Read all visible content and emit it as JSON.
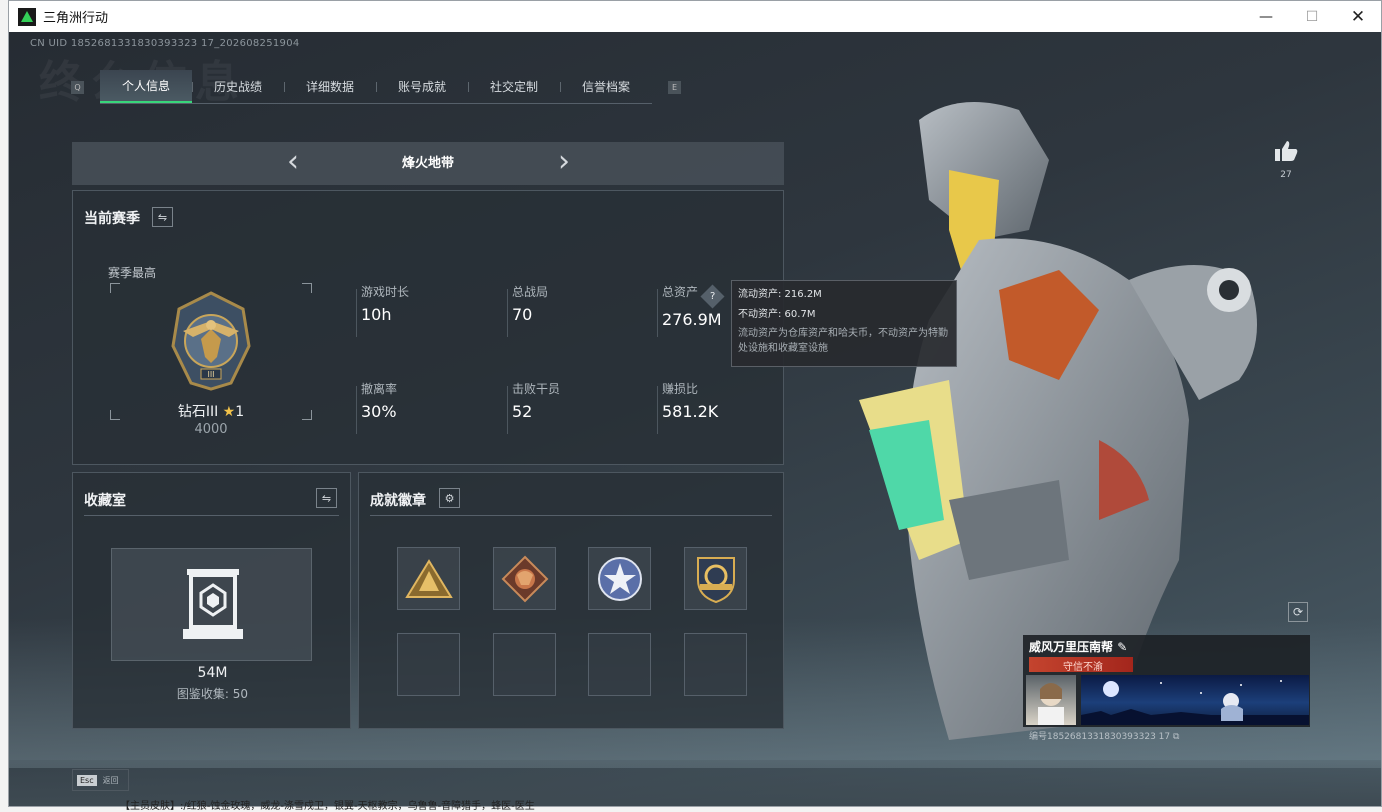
{
  "window": {
    "title": "三角洲行动",
    "min": "—",
    "max": "☐",
    "close": "✕"
  },
  "uid": "CN UID 1852681331830393323 17_202608251904",
  "bg_word": "终么信息",
  "tabs": {
    "left_key": "Q",
    "right_key": "E",
    "items": [
      {
        "label": "个人信息",
        "active": true
      },
      {
        "label": "历史战绩",
        "active": false
      },
      {
        "label": "详细数据",
        "active": false
      },
      {
        "label": "账号成就",
        "active": false
      },
      {
        "label": "社交定制",
        "active": false
      },
      {
        "label": "信誉档案",
        "active": false
      }
    ]
  },
  "mode": {
    "title": "烽火地带",
    "prev": "‹",
    "next": "›"
  },
  "season": {
    "title": "当前赛季",
    "season_high": "赛季最高",
    "rank_name": "钻石III",
    "rank_star": "★",
    "rank_star_count": "1",
    "rank_points": "4000",
    "stats": {
      "play_time": {
        "label": "游戏时长",
        "value": "10h"
      },
      "total_matches": {
        "label": "总战局",
        "value": "70"
      },
      "total_assets": {
        "label": "总资产",
        "value": "276.9M"
      },
      "extract_rate": {
        "label": "撤离率",
        "value": "30%"
      },
      "kills": {
        "label": "击败干员",
        "value": "52"
      },
      "profit_ratio": {
        "label": "赚损比",
        "value": "581.2K"
      }
    }
  },
  "tooltip": {
    "liquid": "流动资产: 216.2M",
    "fixed": "不动资产: 60.7M",
    "note": "流动资产为仓库资产和哈夫币，不动资产为特勤处设施和收藏室设施"
  },
  "collection": {
    "title": "收藏室",
    "value": "54M",
    "sub": "图鉴收集: 50"
  },
  "achievements": {
    "title": "成就徽章"
  },
  "esc": {
    "key": "Esc",
    "label": "返回"
  },
  "like": {
    "count": "27"
  },
  "card": {
    "name": "威风万里压南帮",
    "title": "守信不渝",
    "id": "编号1852681331830393323 17"
  },
  "below_text": "【主员皮肤】:/红狼-蚀金玫瑰，威龙-涤雪戍卫，银翼-天枢教宗，乌鲁鲁-音障猎手，蜂医-医生"
}
